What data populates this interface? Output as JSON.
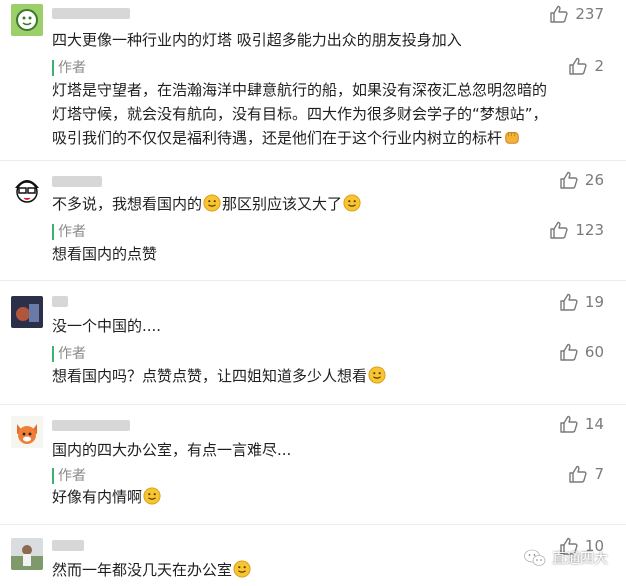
{
  "comments": [
    {
      "likes": "237",
      "text": "四大更像一种行业内的灯塔 吸引超多能力出众的朋友投身加入",
      "reply": {
        "author_label": "作者",
        "likes": "2",
        "lines": [
          "灯塔是守望者，在浩瀚海洋中肆意航行的船，如果没有深夜汇总忽明忽暗的",
          "灯塔守候，就会没有航向，没有目标。四大作为很多财会学子的“梦想站”，",
          "吸引我们的不仅仅是福利待遇，还是他们在于这个行业内树立的标杆"
        ]
      }
    },
    {
      "likes": "26",
      "text_a": "不多说，我想看国内的",
      "text_b": "那区别应该又大了",
      "reply": {
        "author_label": "作者",
        "likes": "123",
        "text": "想看国内的点赞"
      }
    },
    {
      "likes": "19",
      "text": "没一个中国的....",
      "reply": {
        "author_label": "作者",
        "likes": "60",
        "text": "想看国内吗？点赞点赞，让四姐知道多少人想看"
      }
    },
    {
      "likes": "14",
      "text": "国内的四大办公室，有点一言难尽...",
      "reply": {
        "author_label": "作者",
        "likes": "7",
        "text": "好像有内情啊"
      }
    },
    {
      "likes": "10",
      "text": "然而一年都没几天在办公室"
    }
  ],
  "watermark": "直通四大",
  "colors": {
    "author_bar": "#3cb371",
    "like_icon": "#7a7a7a"
  }
}
